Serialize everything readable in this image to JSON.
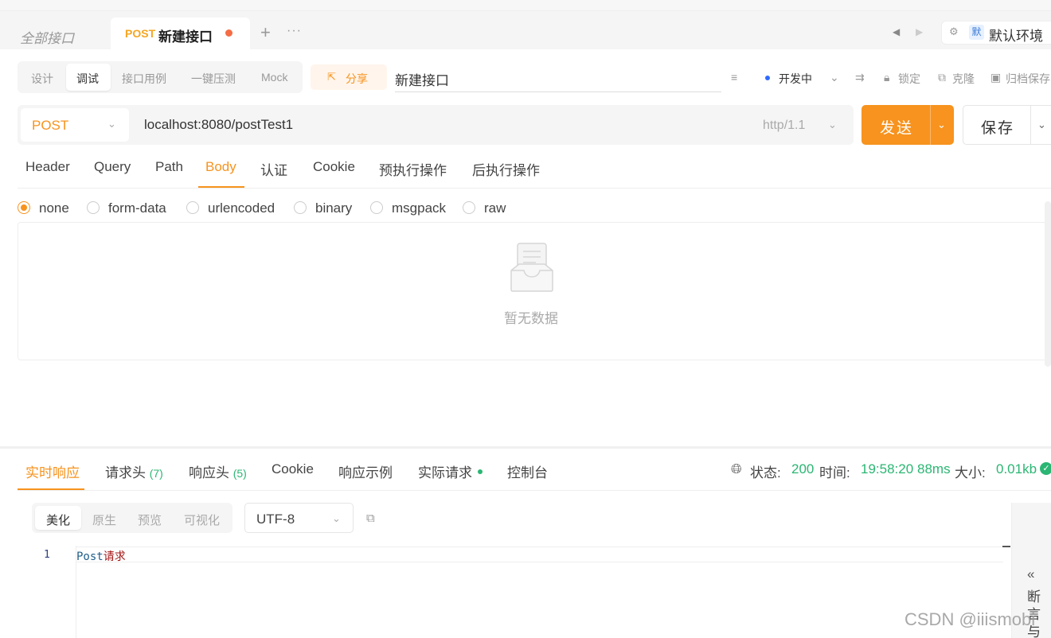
{
  "tabs": {
    "all_label": "全部接口",
    "active": {
      "method": "POST",
      "title": "新建接口"
    },
    "add_symbol": "+",
    "more_symbol": "···"
  },
  "env": {
    "badge": "默",
    "label": "默认环境"
  },
  "modes": {
    "items": [
      "设计",
      "调试",
      "接口用例",
      "一键压测",
      "Mock"
    ],
    "active": "调试"
  },
  "share": {
    "label": "分享"
  },
  "api_name": {
    "value": "新建接口"
  },
  "toolbar": {
    "status": "开发中",
    "lock": "锁定",
    "clone": "克隆",
    "archive": "归档保存"
  },
  "request": {
    "method": "POST",
    "url": "localhost:8080/postTest1",
    "http_version": "http/1.1",
    "send_label": "发送",
    "save_label": "保存"
  },
  "request_tabs": {
    "items": [
      "Header",
      "Query",
      "Path",
      "Body",
      "认证",
      "Cookie",
      "预执行操作",
      "后执行操作"
    ],
    "active": "Body"
  },
  "body_types": {
    "items": [
      "none",
      "form-data",
      "urlencoded",
      "binary",
      "msgpack",
      "raw"
    ],
    "selected": "none"
  },
  "empty_state": {
    "text": "暂无数据"
  },
  "response_tabs": {
    "live": "实时响应",
    "req_headers": "请求头",
    "req_headers_count": "(7)",
    "res_headers": "响应头",
    "res_headers_count": "(5)",
    "cookie": "Cookie",
    "example": "响应示例",
    "actual": "实际请求",
    "console": "控制台"
  },
  "status_bar": {
    "status_label": "状态:",
    "status_value": "200",
    "time_label": "时间:",
    "time_value": "19:58:20",
    "duration": "88ms",
    "size_label": "大小:",
    "size_value": "0.01kb"
  },
  "format": {
    "items": [
      "美化",
      "原生",
      "预览",
      "可视化"
    ],
    "active": "美化",
    "encoding": "UTF-8"
  },
  "code": {
    "line_number": "1",
    "text_en": "Post",
    "text_cn": "请求"
  },
  "side_panel": {
    "chevron": "«",
    "text": "断言与"
  },
  "watermark": "CSDN @iiismobi",
  "colors": {
    "accent": "#f7931e",
    "success": "#2bb673",
    "method": "#f5a623"
  }
}
